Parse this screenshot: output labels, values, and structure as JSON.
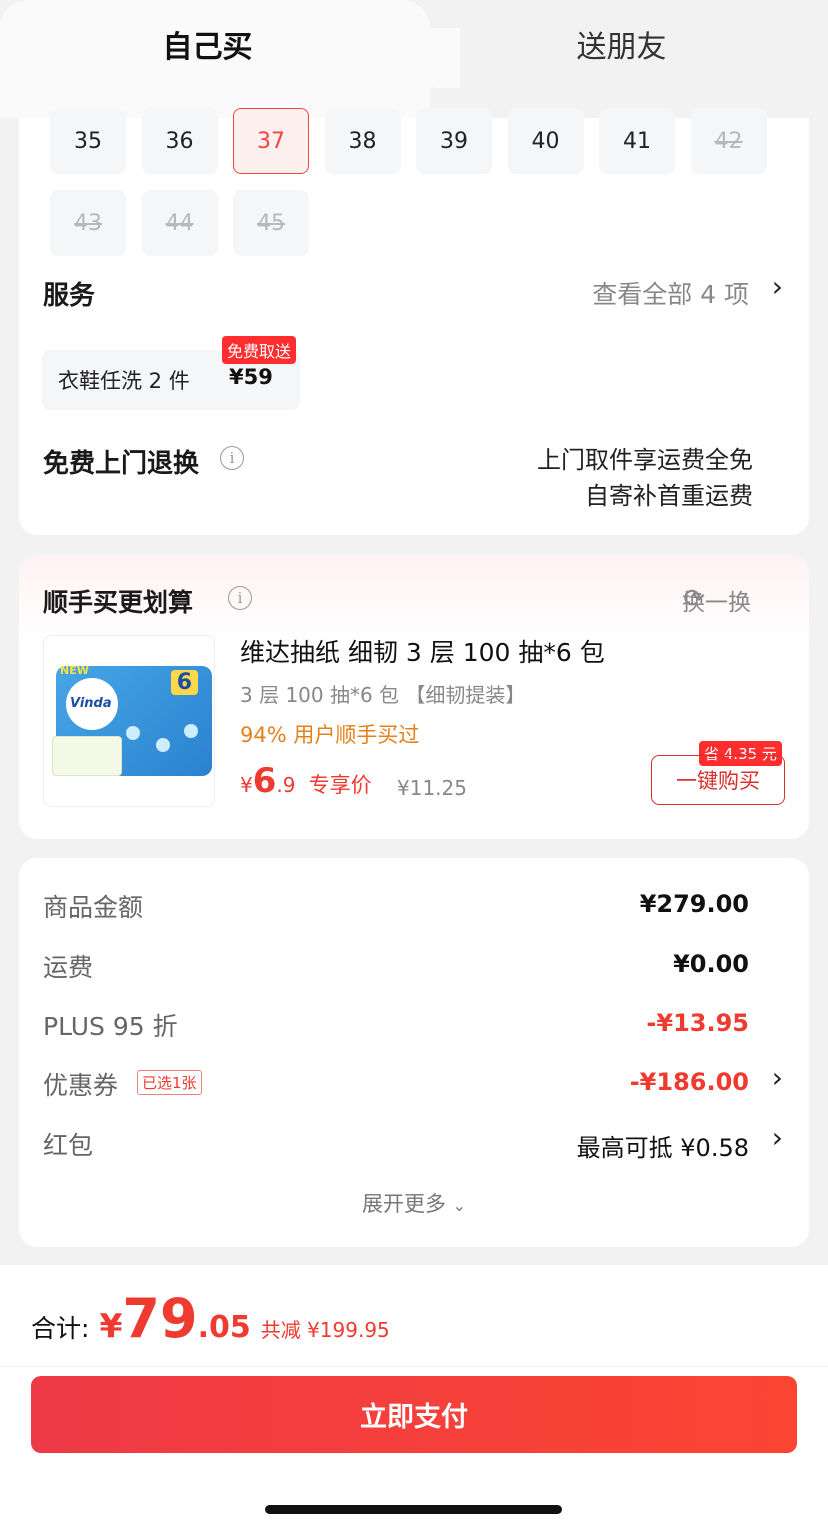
{
  "tabs": {
    "self_buy": "自己买",
    "gift": "送朋友"
  },
  "sizes": [
    {
      "label": "35",
      "state": "normal"
    },
    {
      "label": "36",
      "state": "normal"
    },
    {
      "label": "37",
      "state": "selected"
    },
    {
      "label": "38",
      "state": "normal"
    },
    {
      "label": "39",
      "state": "normal"
    },
    {
      "label": "40",
      "state": "normal"
    },
    {
      "label": "41",
      "state": "normal"
    },
    {
      "label": "42",
      "state": "disabled"
    },
    {
      "label": "43",
      "state": "disabled"
    },
    {
      "label": "44",
      "state": "disabled"
    },
    {
      "label": "45",
      "state": "disabled"
    }
  ],
  "service": {
    "title": "服务",
    "view_all": "查看全部 4 项",
    "item_name": "衣鞋任洗 2 件",
    "item_price": "¥59",
    "item_badge": "免费取送"
  },
  "returns": {
    "title": "免费上门退换",
    "line1": "上门取件享运费全免",
    "line2": "自寄补首重运费"
  },
  "addon": {
    "title": "顺手买更划算",
    "refresh": "换一换",
    "product_name": "维达抽纸 细韧 3 层 100 抽*6 包",
    "spec": "3 层 100 抽*6 包 【细韧提装】",
    "social_proof": "94% 用户顺手买过",
    "price_symbol": "¥",
    "price_int": "6",
    "price_dec": ".9",
    "price_label": "专享价",
    "original_price": "¥11.25",
    "save_badge": "省 4.35 元",
    "buy_button": "一键购买",
    "image_brand": "Vinda",
    "image_tag": "NEW",
    "image_count": "6"
  },
  "summary": {
    "goods_label": "商品金额",
    "goods_value": "¥279.00",
    "shipping_label": "运费",
    "shipping_value": "¥0.00",
    "plus_label": "PLUS 95 折",
    "plus_value": "-¥13.95",
    "coupon_label": "优惠券",
    "coupon_tag": "已选1张",
    "coupon_value": "-¥186.00",
    "redpack_label": "红包",
    "redpack_value": "最高可抵 ¥0.58",
    "expand": "展开更多"
  },
  "footer": {
    "total_label": "合计:",
    "total_symbol": "¥",
    "total_int": "79",
    "total_dec": ".05",
    "discount": "共减 ¥199.95",
    "pay_button": "立即支付"
  },
  "colors": {
    "accent": "#ef3a30",
    "selected_border": "#f2453d"
  }
}
